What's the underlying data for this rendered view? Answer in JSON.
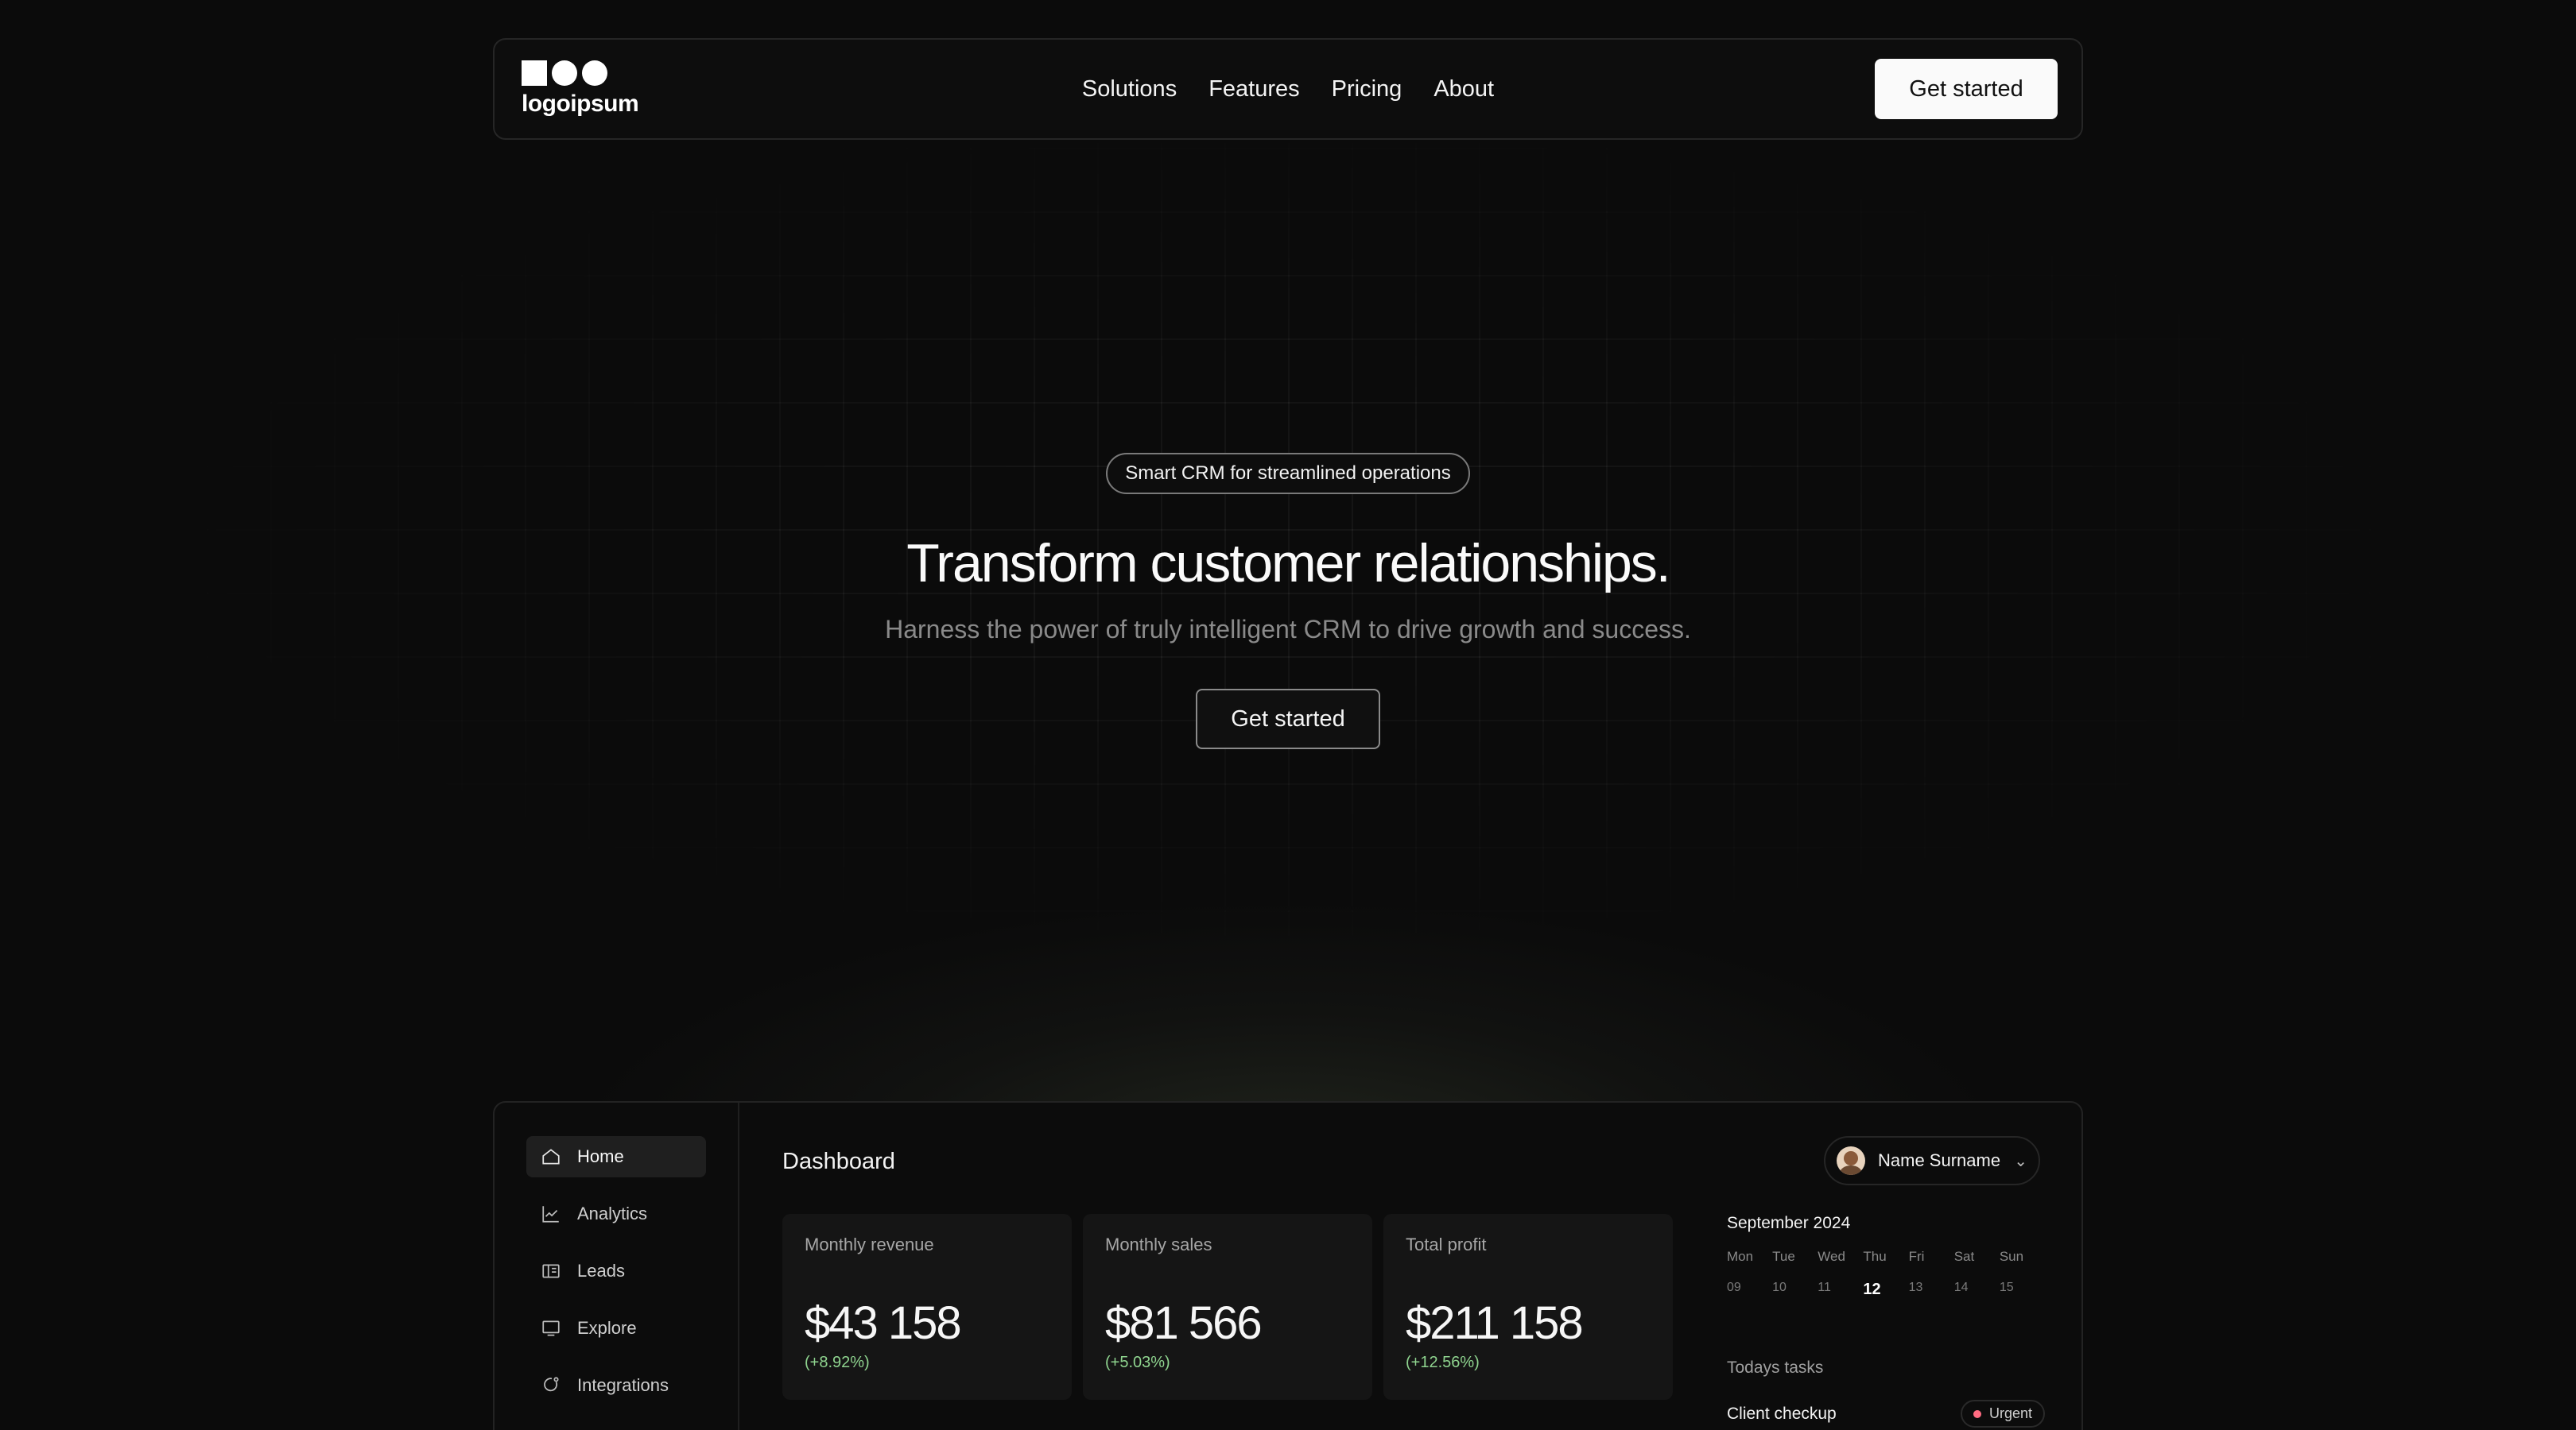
{
  "brand": {
    "name": "logoipsum"
  },
  "nav": {
    "links": [
      "Solutions",
      "Features",
      "Pricing",
      "About"
    ],
    "cta": "Get started"
  },
  "hero": {
    "badge": "Smart CRM for streamlined operations",
    "title": "Transform customer relationships.",
    "subtitle": "Harness the power of truly intelligent CRM to drive growth and success.",
    "cta": "Get started"
  },
  "dashboard": {
    "title": "Dashboard",
    "sidebar": [
      {
        "label": "Home",
        "icon": "home-icon",
        "active": true
      },
      {
        "label": "Analytics",
        "icon": "chart-icon",
        "active": false
      },
      {
        "label": "Leads",
        "icon": "leads-icon",
        "active": false
      },
      {
        "label": "Explore",
        "icon": "monitor-icon",
        "active": false
      },
      {
        "label": "Integrations",
        "icon": "integrations-icon",
        "active": false
      }
    ],
    "user": {
      "name": "Name Surname"
    },
    "cards": [
      {
        "label": "Monthly revenue",
        "value": "$43 158",
        "delta": "(+8.92%)"
      },
      {
        "label": "Monthly sales",
        "value": "$81 566",
        "delta": "(+5.03%)"
      },
      {
        "label": "Total profit",
        "value": "$211 158",
        "delta": "(+12.56%)"
      }
    ],
    "calendar": {
      "month": "September 2024",
      "days": [
        "Mon",
        "Tue",
        "Wed",
        "Thu",
        "Fri",
        "Sat",
        "Sun"
      ],
      "dates": [
        "09",
        "10",
        "11",
        "12",
        "13",
        "14",
        "15"
      ],
      "today": "12"
    },
    "tasks": {
      "heading": "Todays tasks",
      "items": [
        {
          "name": "Client checkup",
          "priority": "Urgent"
        }
      ]
    }
  },
  "colors": {
    "background": "#0b0b0b",
    "positive": "#8fd48f",
    "urgent": "#ff6b81"
  }
}
